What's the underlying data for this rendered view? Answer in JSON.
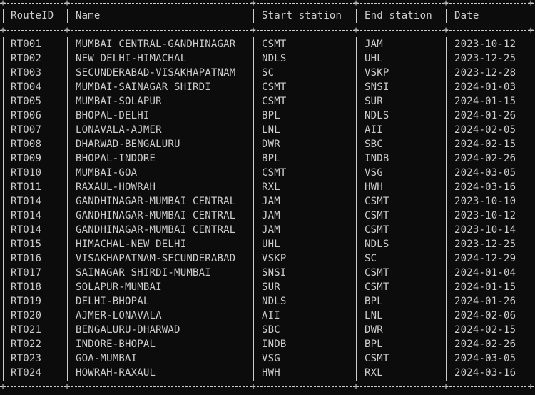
{
  "table": {
    "headers": [
      "RouteID",
      "Name",
      "Start_station",
      "End_station",
      "Date"
    ],
    "rows": [
      [
        "RT001",
        "MUMBAI CENTRAL-GANDHINAGAR",
        "CSMT",
        "JAM",
        "2023-10-12"
      ],
      [
        "RT002",
        "NEW DELHI-HIMACHAL",
        "NDLS",
        "UHL",
        "2023-12-25"
      ],
      [
        "RT003",
        "SECUNDERABAD-VISAKHAPATNAM",
        "SC",
        "VSKP",
        "2023-12-28"
      ],
      [
        "RT004",
        "MUMBAI-SAINAGAR SHIRDI",
        "CSMT",
        "SNSI",
        "2024-01-03"
      ],
      [
        "RT005",
        "MUMBAI-SOLAPUR",
        "CSMT",
        "SUR",
        "2024-01-15"
      ],
      [
        "RT006",
        "BHOPAL-DELHI",
        "BPL",
        "NDLS",
        "2024-01-26"
      ],
      [
        "RT007",
        "LONAVALA-AJMER",
        "LNL",
        "AII",
        "2024-02-05"
      ],
      [
        "RT008",
        "DHARWAD-BENGALURU",
        "DWR",
        "SBC",
        "2024-02-15"
      ],
      [
        "RT009",
        "BHOPAL-INDORE",
        "BPL",
        "INDB",
        "2024-02-26"
      ],
      [
        "RT010",
        "MUMBAI-GOA",
        "CSMT",
        "VSG",
        "2024-03-05"
      ],
      [
        "RT011",
        "RAXAUL-HOWRAH",
        "RXL",
        "HWH",
        "2024-03-16"
      ],
      [
        "RT014",
        "GANDHINAGAR-MUMBAI CENTRAL",
        "JAM",
        "CSMT",
        "2023-10-10"
      ],
      [
        "RT014",
        "GANDHINAGAR-MUMBAI CENTRAL",
        "JAM",
        "CSMT",
        "2023-10-12"
      ],
      [
        "RT014",
        "GANDHINAGAR-MUMBAI CENTRAL",
        "JAM",
        "CSMT",
        "2023-10-14"
      ],
      [
        "RT015",
        "HIMACHAL-NEW DELHI",
        "UHL",
        "NDLS",
        "2023-12-25"
      ],
      [
        "RT016",
        "VISAKHAPATNAM-SECUNDERABAD",
        "VSKP",
        "SC",
        "2024-12-29"
      ],
      [
        "RT017",
        "SAINAGAR SHIRDI-MUMBAI",
        "SNSI",
        "CSMT",
        "2024-01-04"
      ],
      [
        "RT018",
        "SOLAPUR-MUMBAI",
        "SUR",
        "CSMT",
        "2024-01-15"
      ],
      [
        "RT019",
        "DELHI-BHOPAL",
        "NDLS",
        "BPL",
        "2024-01-26"
      ],
      [
        "RT020",
        "AJMER-LONAVALA",
        "AII",
        "LNL",
        "2024-02-06"
      ],
      [
        "RT021",
        "BENGALURU-DHARWAD",
        "SBC",
        "DWR",
        "2024-02-15"
      ],
      [
        "RT022",
        "INDORE-BHOPAL",
        "INDB",
        "BPL",
        "2024-02-26"
      ],
      [
        "RT023",
        "GOA-MUMBAI",
        "VSG",
        "CSMT",
        "2024-03-05"
      ],
      [
        "RT024",
        "HOWRAH-RAXAUL",
        "HWH",
        "RXL",
        "2024-03-16"
      ]
    ]
  }
}
